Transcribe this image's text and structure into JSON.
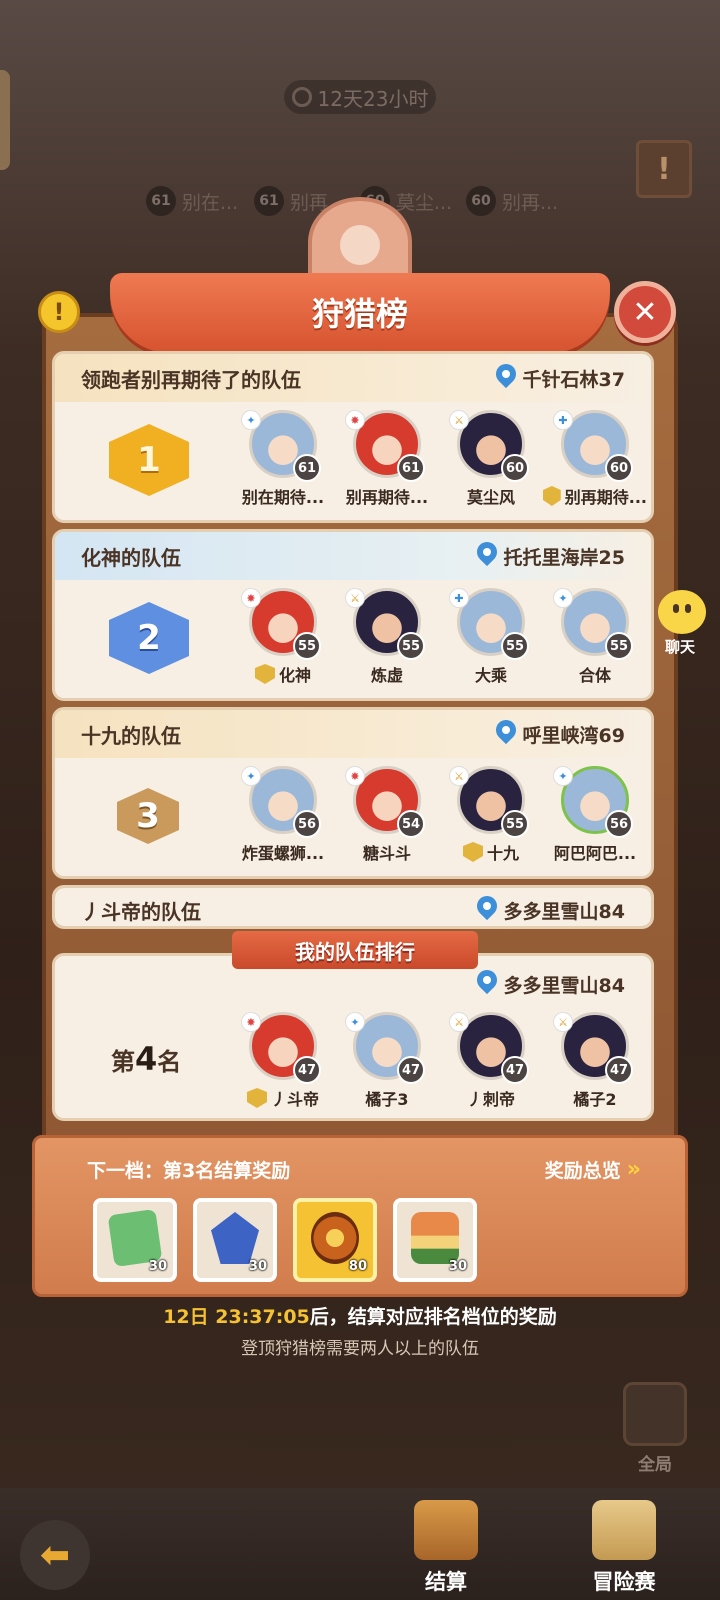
{
  "timer": "12天23小时",
  "top_ranks": [
    {
      "level": "61",
      "name": "别在..."
    },
    {
      "level": "61",
      "name": "别再..."
    },
    {
      "level": "60",
      "name": "莫尘..."
    },
    {
      "level": "60",
      "name": "别再..."
    }
  ],
  "title": "狩猎榜",
  "teams": [
    {
      "rank": "1",
      "name": "领跑者别再期待了的队伍",
      "location": "千针石林37",
      "members": [
        {
          "name": "别在期待...",
          "level": "61"
        },
        {
          "name": "别再期待...",
          "level": "61"
        },
        {
          "name": "莫尘风",
          "level": "60"
        },
        {
          "name": "别再期待...",
          "level": "60"
        }
      ]
    },
    {
      "rank": "2",
      "name": "化神的队伍",
      "location": "托托里海岸25",
      "members": [
        {
          "name": "化神",
          "level": "55"
        },
        {
          "name": "炼虚",
          "level": "55"
        },
        {
          "name": "大乘",
          "level": "55"
        },
        {
          "name": "合体",
          "level": "55"
        }
      ]
    },
    {
      "rank": "3",
      "name": "十九的队伍",
      "location": "呼里峡湾69",
      "members": [
        {
          "name": "炸蛋螺狮...",
          "level": "56"
        },
        {
          "name": "糖斗斗",
          "level": "54"
        },
        {
          "name": "十九",
          "level": "55"
        },
        {
          "name": "阿巴阿巴...",
          "level": "56"
        }
      ]
    },
    {
      "name": "丿斗帝的队伍",
      "location": "多多里雪山84"
    }
  ],
  "my_team": {
    "ribbon": "我的队伍排行",
    "location": "多多里雪山84",
    "rank_prefix": "第",
    "rank": "4",
    "rank_suffix": "名",
    "members": [
      {
        "name": "丿斗帝",
        "level": "47"
      },
      {
        "name": "橘子3",
        "level": "47"
      },
      {
        "name": "丿刺帝",
        "level": "47"
      },
      {
        "name": "橘子2",
        "level": "47"
      }
    ]
  },
  "rewards": {
    "next_label": "下一档：第3名结算奖励",
    "overview": "奖励总览",
    "items": [
      {
        "icon": "green-ticket-icon",
        "count": "30"
      },
      {
        "icon": "blue-crystal-icon",
        "count": "30"
      },
      {
        "icon": "fire-egg-icon",
        "count": "80"
      },
      {
        "icon": "food-plate-icon",
        "count": "30"
      }
    ]
  },
  "settle_time": "12日 23:37:05",
  "settle_text": "后，结算对应排名档位的奖励",
  "hint": "登顶狩猎榜需要两人以上的队伍",
  "side": {
    "chat": "聊天",
    "global": "全局"
  },
  "bottom": {
    "settle": "结算",
    "adventure": "冒险赛"
  },
  "colors": {
    "accent": "#e66a45",
    "gold": "#f5c234",
    "pin": "#3c8fd8"
  }
}
